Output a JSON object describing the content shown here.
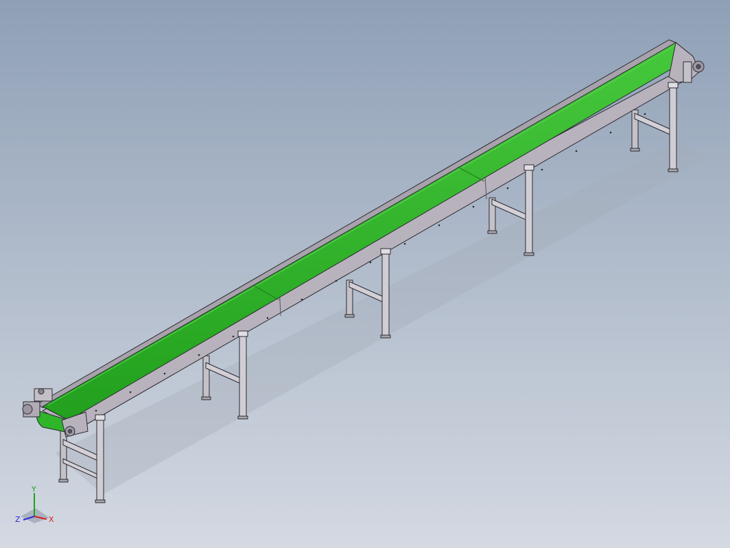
{
  "scene": {
    "background_top": "#8fa0b6",
    "background_bottom": "#d4d9e2",
    "belt_color": "#2fb52a",
    "belt_highlight": "#55d24a",
    "frame_color": "#b8b2bc",
    "frame_dark": "#8b858f",
    "leg_color": "#c4c2c8",
    "outline_color": "#2a2a30"
  },
  "triad": {
    "x_label": "X",
    "y_label": "Y",
    "z_label": "Z",
    "x_color": "#d42020",
    "y_color": "#1aa41a",
    "z_color": "#2a2ad4"
  }
}
